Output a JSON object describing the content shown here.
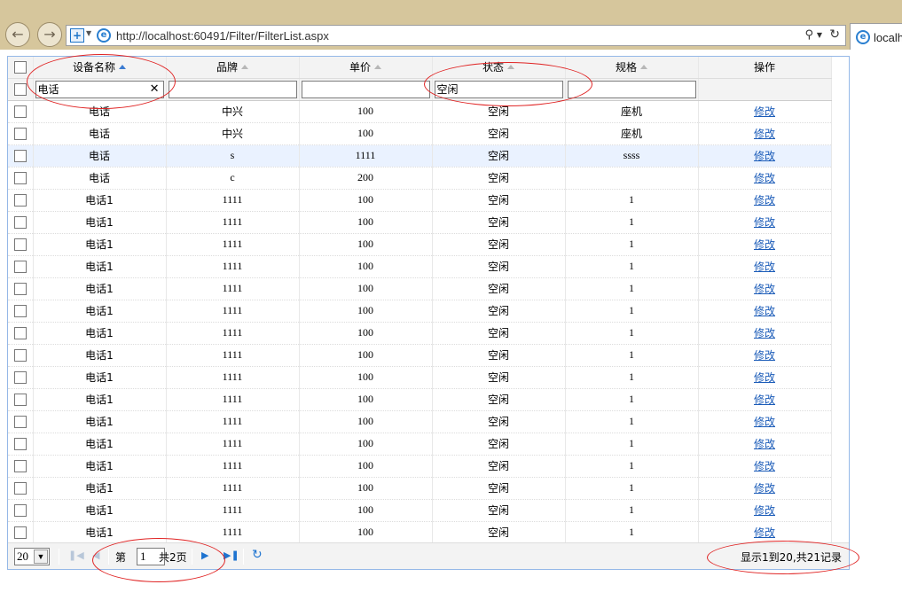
{
  "browser": {
    "url": "http://localhost:60491/Filter/FilterList.aspx",
    "tab_title": "localhost"
  },
  "icons": {
    "back": "back-arrow-icon",
    "forward": "forward-arrow-icon",
    "compat": "compatibility-shield-icon",
    "ie": "ie-logo-icon",
    "search": "search-icon",
    "refresh": "refresh-icon"
  },
  "colors": {
    "grid_border": "#95b8e7",
    "highlight_row": "#eaf2ff",
    "link": "#1a5bb8",
    "annotation": "#e02424"
  },
  "grid": {
    "columns": [
      {
        "label": "设备名称",
        "sort": "asc"
      },
      {
        "label": "品牌",
        "sort": "none"
      },
      {
        "label": "单价",
        "sort": "none"
      },
      {
        "label": "状态",
        "sort": "none"
      },
      {
        "label": "规格",
        "sort": "none"
      },
      {
        "label": "操作",
        "sort": ""
      }
    ],
    "filters": {
      "name": "电话",
      "brand": "",
      "price": "",
      "status": "空闲",
      "spec": ""
    },
    "rows": [
      [
        "电话",
        "中兴",
        "100",
        "空闲",
        "座机",
        "修改"
      ],
      [
        "电话",
        "中兴",
        "100",
        "空闲",
        "座机",
        "修改"
      ],
      [
        "电话",
        "s",
        "1111",
        "空闲",
        "ssss",
        "修改"
      ],
      [
        "电话",
        "c",
        "200",
        "空闲",
        "",
        "修改"
      ],
      [
        "电话1",
        "1111",
        "100",
        "空闲",
        "1",
        "修改"
      ],
      [
        "电话1",
        "1111",
        "100",
        "空闲",
        "1",
        "修改"
      ],
      [
        "电话1",
        "1111",
        "100",
        "空闲",
        "1",
        "修改"
      ],
      [
        "电话1",
        "1111",
        "100",
        "空闲",
        "1",
        "修改"
      ],
      [
        "电话1",
        "1111",
        "100",
        "空闲",
        "1",
        "修改"
      ],
      [
        "电话1",
        "1111",
        "100",
        "空闲",
        "1",
        "修改"
      ],
      [
        "电话1",
        "1111",
        "100",
        "空闲",
        "1",
        "修改"
      ],
      [
        "电话1",
        "1111",
        "100",
        "空闲",
        "1",
        "修改"
      ],
      [
        "电话1",
        "1111",
        "100",
        "空闲",
        "1",
        "修改"
      ],
      [
        "电话1",
        "1111",
        "100",
        "空闲",
        "1",
        "修改"
      ],
      [
        "电话1",
        "1111",
        "100",
        "空闲",
        "1",
        "修改"
      ],
      [
        "电话1",
        "1111",
        "100",
        "空闲",
        "1",
        "修改"
      ],
      [
        "电话1",
        "1111",
        "100",
        "空闲",
        "1",
        "修改"
      ],
      [
        "电话1",
        "1111",
        "100",
        "空闲",
        "1",
        "修改"
      ],
      [
        "电话1",
        "1111",
        "100",
        "空闲",
        "1",
        "修改"
      ],
      [
        "电话1",
        "1111",
        "100",
        "空闲",
        "1",
        "修改"
      ]
    ],
    "highlighted_row": 3
  },
  "pager": {
    "page_size": "20",
    "page_prefix": "第",
    "current_page": "1",
    "total_pages_label": "共2页",
    "info": "显示1到20,共21记录"
  }
}
